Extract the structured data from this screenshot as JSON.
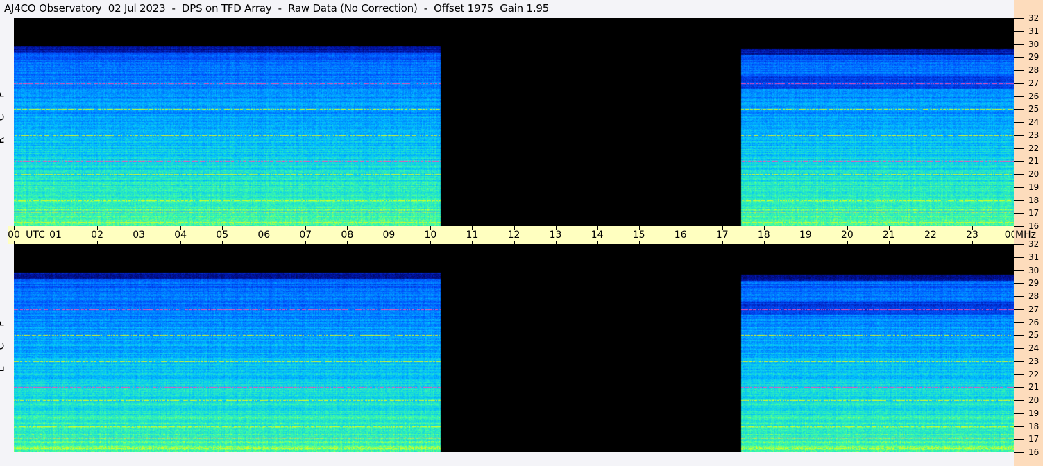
{
  "title": "AJ4CO Observatory  02 Jul 2023  -  DPS on TFD Array  -  Raw Data (No Correction)  -  Offset 1975  Gain 1.95",
  "chart_data": {
    "type": "heatmap",
    "title": "AJ4CO Observatory  02 Jul 2023  -  DPS on TFD Array  -  Raw Data (No Correction)  -  Offset 1975  Gain 1.95",
    "xlabel": "UTC",
    "ylabel": "MHz",
    "x_range_hours": [
      0,
      24
    ],
    "y_range_mhz": [
      16,
      32
    ],
    "x_tick_labels": [
      "00",
      "01",
      "02",
      "03",
      "04",
      "05",
      "06",
      "07",
      "08",
      "09",
      "10",
      "11",
      "12",
      "13",
      "14",
      "15",
      "16",
      "17",
      "18",
      "19",
      "20",
      "21",
      "22",
      "23",
      "00"
    ],
    "x_unit_label": "UTC",
    "y_tick_labels": [
      "32",
      "31",
      "30",
      "29",
      "28",
      "27",
      "26",
      "25",
      "24",
      "23",
      "22",
      "21",
      "20",
      "19",
      "18",
      "17",
      "16"
    ],
    "y_unit_label": "MHz",
    "panels": [
      {
        "name": "RCP",
        "label": [
          "R",
          "C",
          "P"
        ]
      },
      {
        "name": "LCP",
        "label": [
          "L",
          "C",
          "P"
        ]
      }
    ],
    "data_segments_hours": [
      [
        0,
        10.25
      ],
      [
        17.45,
        24
      ]
    ],
    "upper_freq_limit_mhz": [
      29.8,
      29.6
    ],
    "interference_lines_mhz": [
      27.0,
      25.0,
      23.0,
      21.0,
      20.0,
      18.0,
      17.1,
      16.3
    ],
    "colormap": [
      "#000010",
      "#0010a0",
      "#0050ff",
      "#00c0ff",
      "#40ffa0",
      "#ffff00",
      "#ff00ff"
    ]
  }
}
